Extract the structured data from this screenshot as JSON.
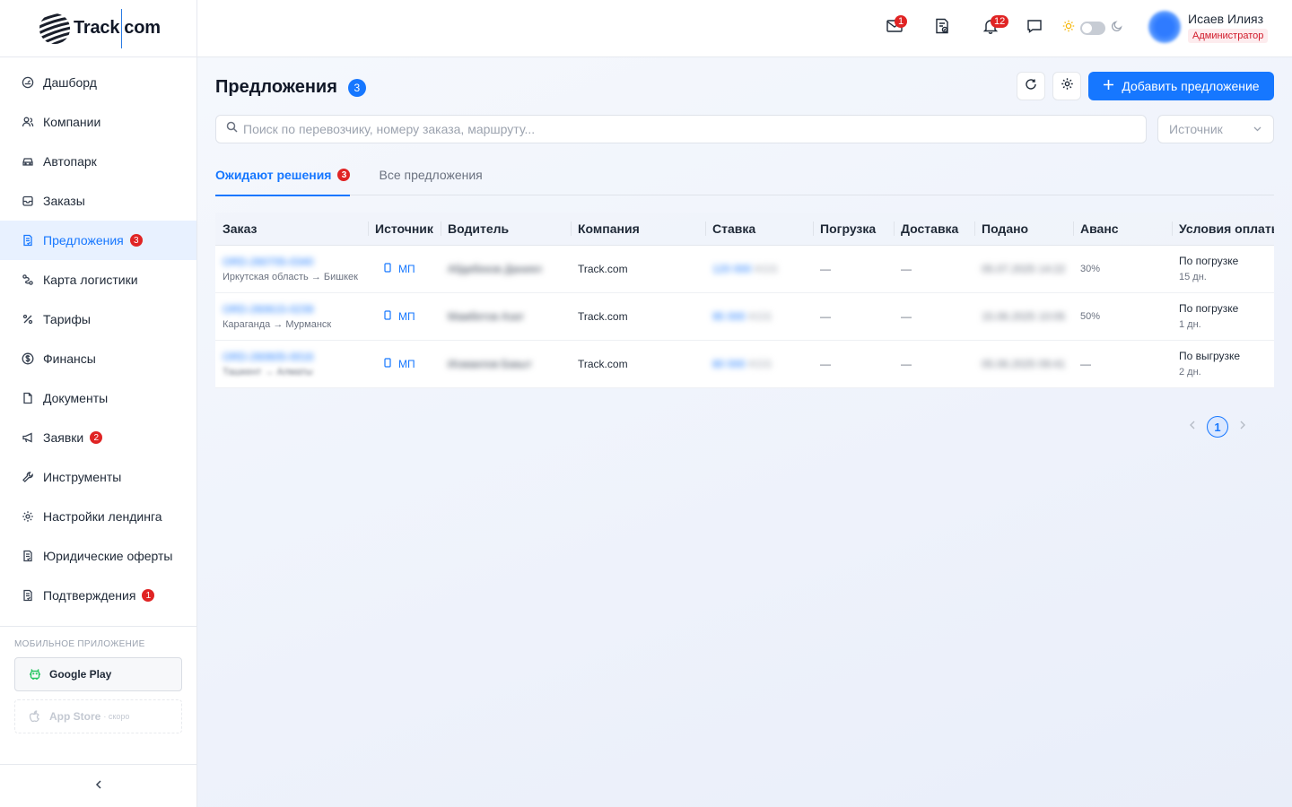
{
  "brand": {
    "part1": "Track",
    "part2": "com"
  },
  "sidebar": {
    "items": [
      {
        "label": "Дашборд",
        "icon": "dashboard-icon"
      },
      {
        "label": "Компании",
        "icon": "users-icon"
      },
      {
        "label": "Автопарк",
        "icon": "car-icon"
      },
      {
        "label": "Заказы",
        "icon": "inbox-icon"
      },
      {
        "label": "Предложения",
        "icon": "file-check-icon",
        "badge": "3",
        "active": true
      },
      {
        "label": "Карта логистики",
        "icon": "route-icon"
      },
      {
        "label": "Тарифы",
        "icon": "percent-icon"
      },
      {
        "label": "Финансы",
        "icon": "dollar-icon"
      },
      {
        "label": "Документы",
        "icon": "document-icon"
      },
      {
        "label": "Заявки",
        "icon": "megaphone-icon",
        "badge": "2"
      },
      {
        "label": "Инструменты",
        "icon": "wrench-icon"
      },
      {
        "label": "Настройки лендинга",
        "icon": "gear-icon"
      },
      {
        "label": "Юридические оферты",
        "icon": "file-check-icon"
      },
      {
        "label": "Подтверждения",
        "icon": "file-check-icon",
        "badge": "1"
      }
    ],
    "mobile": {
      "title": "МОБИЛЬНОЕ ПРИЛОЖЕНИЕ",
      "google_play": "Google Play",
      "app_store": "App Store",
      "app_store_soon": "· скоро"
    }
  },
  "topbar": {
    "mail_badge": "1",
    "bell_badge": "12",
    "user": {
      "name": "Исаев Илияз",
      "role": "Администратор"
    }
  },
  "page": {
    "title": "Предложения",
    "count": "3",
    "add_label": "Добавить предложение",
    "search_placeholder": "Поиск по перевозчику, номеру заказа, маршруту...",
    "source_placeholder": "Источник",
    "tabs": [
      {
        "label": "Ожидают решения",
        "badge": "3",
        "active": true
      },
      {
        "label": "Все предложения"
      }
    ]
  },
  "table": {
    "columns": [
      "Заказ",
      "Источник",
      "Водитель",
      "Компания",
      "Ставка",
      "Погрузка",
      "Доставка",
      "Подано",
      "Аванс",
      "Условия оплаты"
    ],
    "rows": [
      {
        "order": "ORD-260705-0340",
        "route": "Иркутская область → Бишкек",
        "route_blurred": false,
        "source": "МП",
        "driver": "Абдибеков Даниял",
        "company": "Track.com",
        "rate": "120 000",
        "rate_cur": "KGS",
        "loading": "—",
        "delivery": "—",
        "submitted": "05.07.2025 14:22",
        "advance": "30%",
        "terms": "По погрузке",
        "terms_days": "15 дн."
      },
      {
        "order": "ORD-260615-0239",
        "route": "Караганда → Мурманск",
        "route_blurred": false,
        "source": "МП",
        "driver": "Мамбетов Азат",
        "company": "Track.com",
        "rate": "95 000",
        "rate_cur": "KGS",
        "loading": "—",
        "delivery": "—",
        "submitted": "15.06.2025 10:05",
        "advance": "50%",
        "terms": "По погрузке",
        "terms_days": "1 дн."
      },
      {
        "order": "ORD-260605-0016",
        "route": "Ташкент → Алматы",
        "route_blurred": true,
        "source": "МП",
        "driver": "Исмаилов Бакыт",
        "company": "Track.com",
        "rate": "80 000",
        "rate_cur": "KGS",
        "loading": "—",
        "delivery": "—",
        "submitted": "05.06.2025 09:41",
        "advance": "—",
        "terms": "По выгрузке",
        "terms_days": "2 дн."
      }
    ]
  },
  "pagination": {
    "current": "1"
  },
  "colors": {
    "accent": "#1677ff",
    "danger": "#e02424",
    "google_play_icon": "#22c55e"
  }
}
